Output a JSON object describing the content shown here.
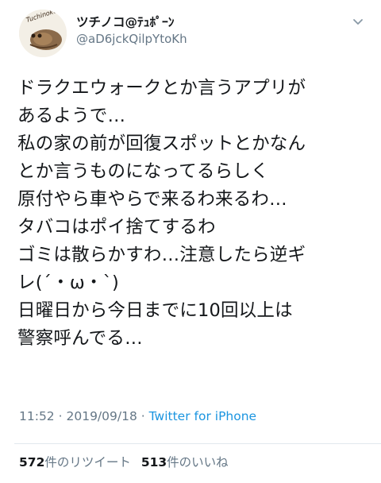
{
  "user": {
    "display_name": "ツチノコ@ﾃｭﾎﾟｰﾝ",
    "handle": "@aD6jckQilpYtoKh",
    "avatar_text": "Tuchinoko"
  },
  "tweet": {
    "lines": [
      "ドラクエウォークとか言うアプリが",
      "あるようで…",
      "私の家の前が回復スポットとかなん",
      "とか言うものになってるらしく",
      "原付やら車やらで来るわ来るわ…",
      "タバコはポイ捨てするわ",
      "ゴミは散らかすわ…注意したら逆ギ",
      "レ(´・ω・`)",
      "日曜日から今日までに10回以上は",
      "警察呼んでる…"
    ],
    "time": "11:52",
    "date": "2019/09/18",
    "separator": "·",
    "source": "Twitter for iPhone"
  },
  "stats": {
    "retweets_count": "572",
    "retweets_label": "件のリツイート",
    "likes_count": "513",
    "likes_label": "件のいいね"
  },
  "icons": {
    "more": "chevron-down-icon",
    "avatar": "avatar-illustration"
  },
  "colors": {
    "link": "#1b95e0",
    "muted": "#657786",
    "text": "#14171a"
  }
}
